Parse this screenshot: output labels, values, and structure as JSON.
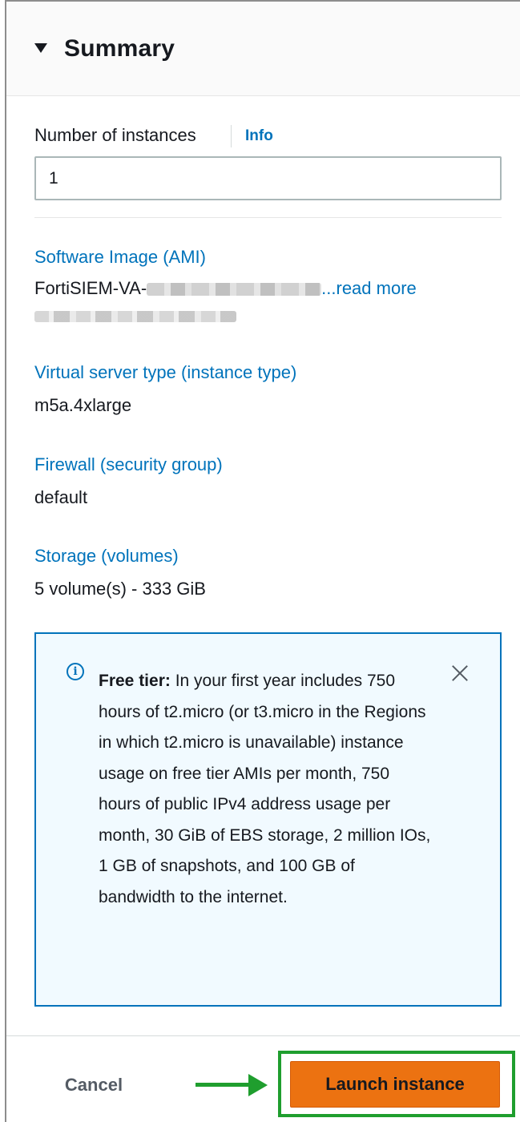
{
  "summary": {
    "title": "Summary",
    "instances_label": "Number of instances",
    "info_link": "Info",
    "instances_value": "1"
  },
  "ami": {
    "label": "Software Image (AMI)",
    "value_prefix": "FortiSIEM-VA-",
    "read_more": "...read more"
  },
  "instance_type": {
    "label": "Virtual server type (instance type)",
    "value": "m5a.4xlarge"
  },
  "firewall": {
    "label": "Firewall (security group)",
    "value": "default"
  },
  "storage": {
    "label": "Storage (volumes)",
    "value": "5 volume(s) - 333 GiB"
  },
  "free_tier": {
    "heading": "Free tier:",
    "body": " In your first year includes 750 hours of t2.micro (or t3.micro in the Regions in which t2.micro is unavailable) instance usage on free tier AMIs per month, 750 hours of public IPv4 address usage per month, 30 GiB of EBS storage, 2 million IOs, 1 GB of snapshots, and 100 GB of bandwidth to the internet."
  },
  "footer": {
    "cancel_label": "Cancel",
    "launch_label": "Launch instance"
  },
  "colors": {
    "link": "#0073bb",
    "primary_button": "#ec7211",
    "annotation": "#1f9e2e",
    "alert_background": "#f1faff"
  },
  "icons": {
    "toggle": "caret-down-icon",
    "alert": "info-circle-icon",
    "dismiss": "close-icon",
    "annotation": "arrow-right-icon"
  }
}
